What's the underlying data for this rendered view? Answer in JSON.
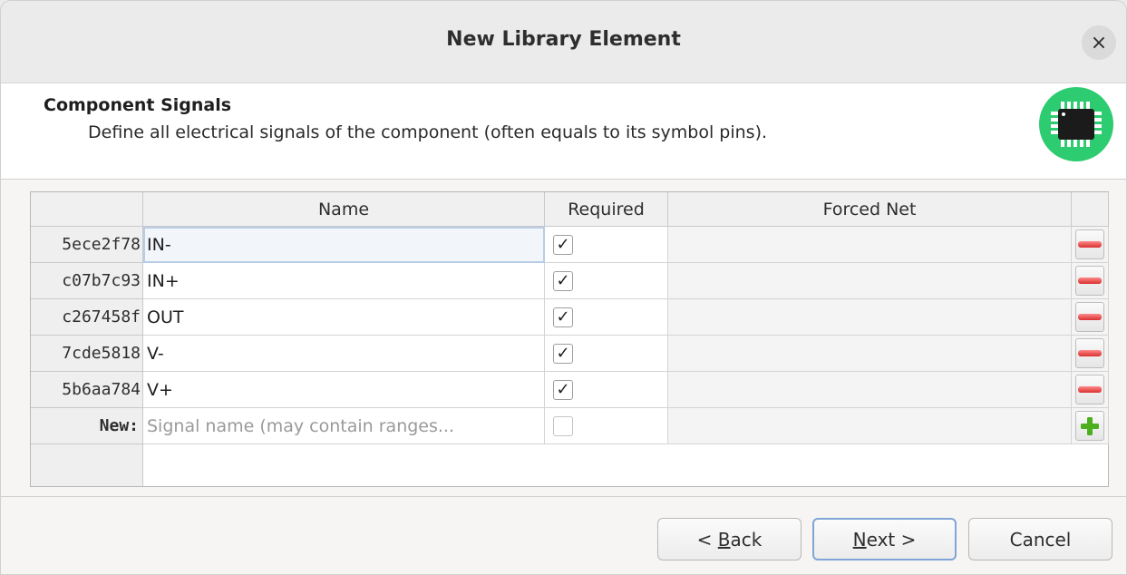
{
  "window": {
    "title": "New Library Element",
    "close_symbol": "×"
  },
  "page": {
    "title": "Component Signals",
    "subtitle": "Define all electrical signals of the component (often equals to its symbol pins)."
  },
  "table": {
    "headers": {
      "name": "Name",
      "required": "Required",
      "forced_net": "Forced Net"
    },
    "rows": [
      {
        "id": "5ece2f78",
        "name": "IN-",
        "required": true,
        "forced_net": ""
      },
      {
        "id": "c07b7c93",
        "name": "IN+",
        "required": true,
        "forced_net": ""
      },
      {
        "id": "c267458f",
        "name": "OUT",
        "required": true,
        "forced_net": ""
      },
      {
        "id": "7cde5818",
        "name": "V-",
        "required": true,
        "forced_net": ""
      },
      {
        "id": "5b6aa784",
        "name": "V+",
        "required": true,
        "forced_net": ""
      }
    ],
    "new_row": {
      "label": "New:",
      "placeholder": "Signal name (may contain ranges...",
      "required": false
    },
    "check_mark": "✓"
  },
  "buttons": {
    "back": {
      "prefix": "< ",
      "mnemonic": "B",
      "rest": "ack"
    },
    "next": {
      "mnemonic": "N",
      "rest": "ext >"
    },
    "cancel": "Cancel"
  },
  "colors": {
    "logo_green": "#2ecc71",
    "remove_red": "#d93030",
    "add_green": "#4caf1e",
    "focus_blue": "#7fa6d6"
  }
}
